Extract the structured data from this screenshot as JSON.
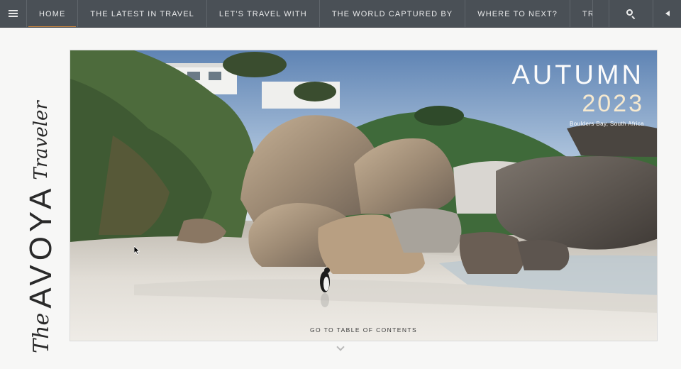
{
  "nav": {
    "menu_icon": "hamburger-icon",
    "items": [
      {
        "label": "HOME"
      },
      {
        "label": "THE LATEST IN TRAVEL"
      },
      {
        "label": "LET'S TRAVEL WITH"
      },
      {
        "label": "THE WORLD CAPTURED BY"
      },
      {
        "label": "WHERE TO NEXT?"
      },
      {
        "label": "TRAVEL THROUGH F"
      }
    ],
    "search_icon": "search-icon",
    "volume_icon": "speaker-icon",
    "accent_color": "#c8843e"
  },
  "brand": {
    "the": "The",
    "name": "AVOYA",
    "traveler": "Traveler"
  },
  "hero": {
    "season": "AUTUMN",
    "year": "2023",
    "location": "Boulders Bay, South Africa",
    "toc_label": "GO TO TABLE OF CONTENTS"
  }
}
